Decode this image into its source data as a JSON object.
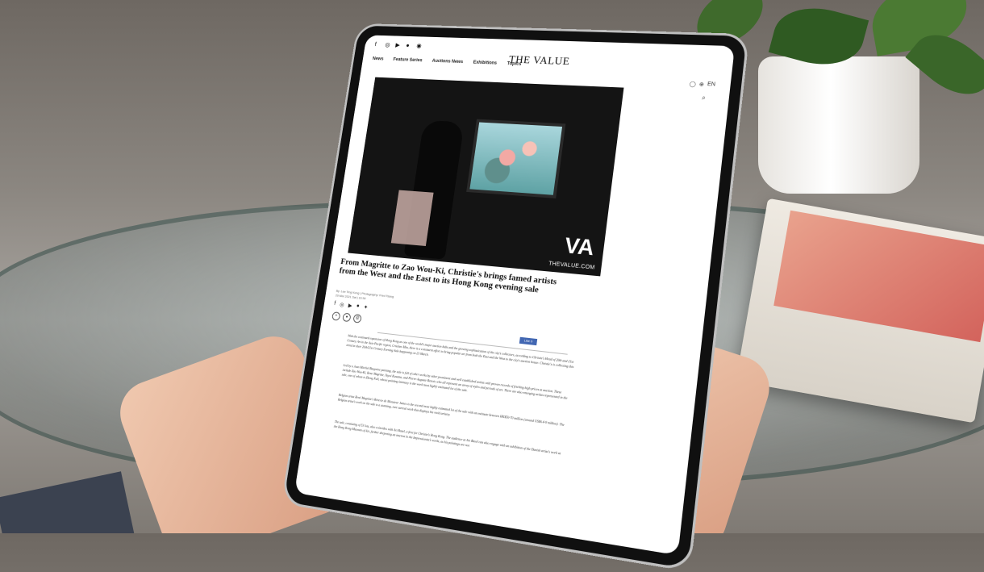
{
  "site": {
    "brand": "THE VALUE",
    "social_icons": [
      "facebook-icon",
      "instagram-icon",
      "youtube-icon",
      "wechat-icon",
      "weibo-icon"
    ],
    "nav": [
      "News",
      "Feature Series",
      "Auctions News",
      "Exhibitions",
      "Topics"
    ],
    "tools": {
      "language": "EN"
    }
  },
  "hero": {
    "logo_text": "VA",
    "site_text": "THEVALUE.COM"
  },
  "article": {
    "title": "From Magritte to Zao Wou-Ki, Christie's brings famed artists from the West and the East to its Hong Kong evening sale",
    "byline": "By: Lee Ting Kong | Photography: Fred Tsang",
    "date": "20 Mar 2021 Sat | 10:30",
    "like_label": "Like 0",
    "paragraphs": [
      "With the continued expansion of Hong Kong as one of the world's major auction hubs and the growing sophistication of the city's collectors, according to Christie's Head of 20th and 21st Century Art in the Asia Pacific region, Cristian Albu, there is a consistent effort to bring popular art from both the East and the West to the city's auction house. Christie's is collecting this trend in their 20th/21st Century Evening Sale happening on 23 March.",
      "Led by a Joan Mitchel Bauprine painting, the sale is full of other works by other prominent and well established artists with proven records of fetching high prices at auction. These include Zao Wou-Ki, Rene Magritte, Yayoi Kusama, and Pierre-Auguste Renoir, who all represent an array of styles and periods of art. There are also emerging artists represented in the sale, one of whom is Zheng Fuli, whose painting intimacy is the work most highly estimated lot of the sale.",
      "Belgian artist René Magritte's Réverie de Monsieur James is the second most highly estimated lot of the sale with an estimate between HK$50-70 million (around US$6.4-9 million). The Belgian artist's work on the sale is a stunning, rare surreal work that displays his vivid artistry.",
      "The sale, consisting of 53 lots, also coincides with Art Basel, a first for Christie's Hong Kong. The audience at Art Basel can also engage with an exhibition of the Danish artist's work at the Hong Kong Museum of Art, further deepening an interest in the Impressionist's works, as his paintings are not"
    ]
  }
}
